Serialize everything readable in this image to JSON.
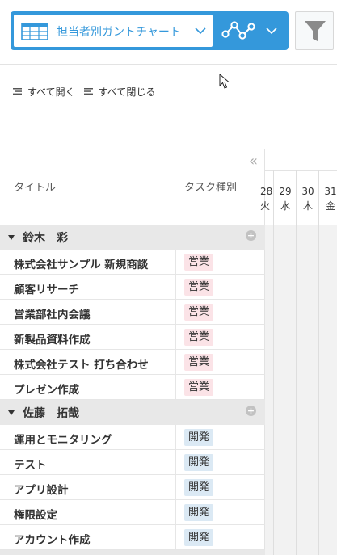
{
  "toolbar": {
    "view_name": "担当者別ガントチャート",
    "icons": {
      "view": "table-grid-icon",
      "graph": "line-graph-icon",
      "filter": "filter-icon",
      "dropdown": "chevron-down-icon"
    }
  },
  "controls": {
    "expand_all": "すべて開く",
    "collapse_all": "すべて閉じる"
  },
  "grid": {
    "columns": {
      "title": "タイトル",
      "type": "タスク種別"
    },
    "collapse_panel": "«",
    "groups": [
      {
        "name": "鈴木　彩",
        "add": "+",
        "tasks": [
          {
            "title": "株式会社サンプル 新規商談",
            "type": "営業"
          },
          {
            "title": "顧客リサーチ",
            "type": "営業"
          },
          {
            "title": "営業部社内会議",
            "type": "営業"
          },
          {
            "title": "新製品資料作成",
            "type": "営業"
          },
          {
            "title": "株式会社テスト 打ち合わせ",
            "type": "営業"
          },
          {
            "title": "プレゼン作成",
            "type": "営業"
          }
        ]
      },
      {
        "name": "佐藤　拓哉",
        "add": "+",
        "tasks": [
          {
            "title": "運用とモニタリング",
            "type": "開発"
          },
          {
            "title": "テスト",
            "type": "開発"
          },
          {
            "title": "アプリ設計",
            "type": "開発"
          },
          {
            "title": "権限設定",
            "type": "開発"
          },
          {
            "title": "アカウント作成",
            "type": "開発"
          }
        ]
      }
    ]
  },
  "timeline": {
    "days": [
      {
        "date": "28",
        "weekday": "火"
      },
      {
        "date": "29",
        "weekday": "水"
      },
      {
        "date": "30",
        "weekday": "木"
      },
      {
        "date": "31",
        "weekday": "金"
      }
    ]
  },
  "colors": {
    "accent": "#3498db",
    "sales_badge": "#fbe3e7",
    "dev_badge": "#dbe9f4",
    "group_bg": "#e8e8e8"
  }
}
